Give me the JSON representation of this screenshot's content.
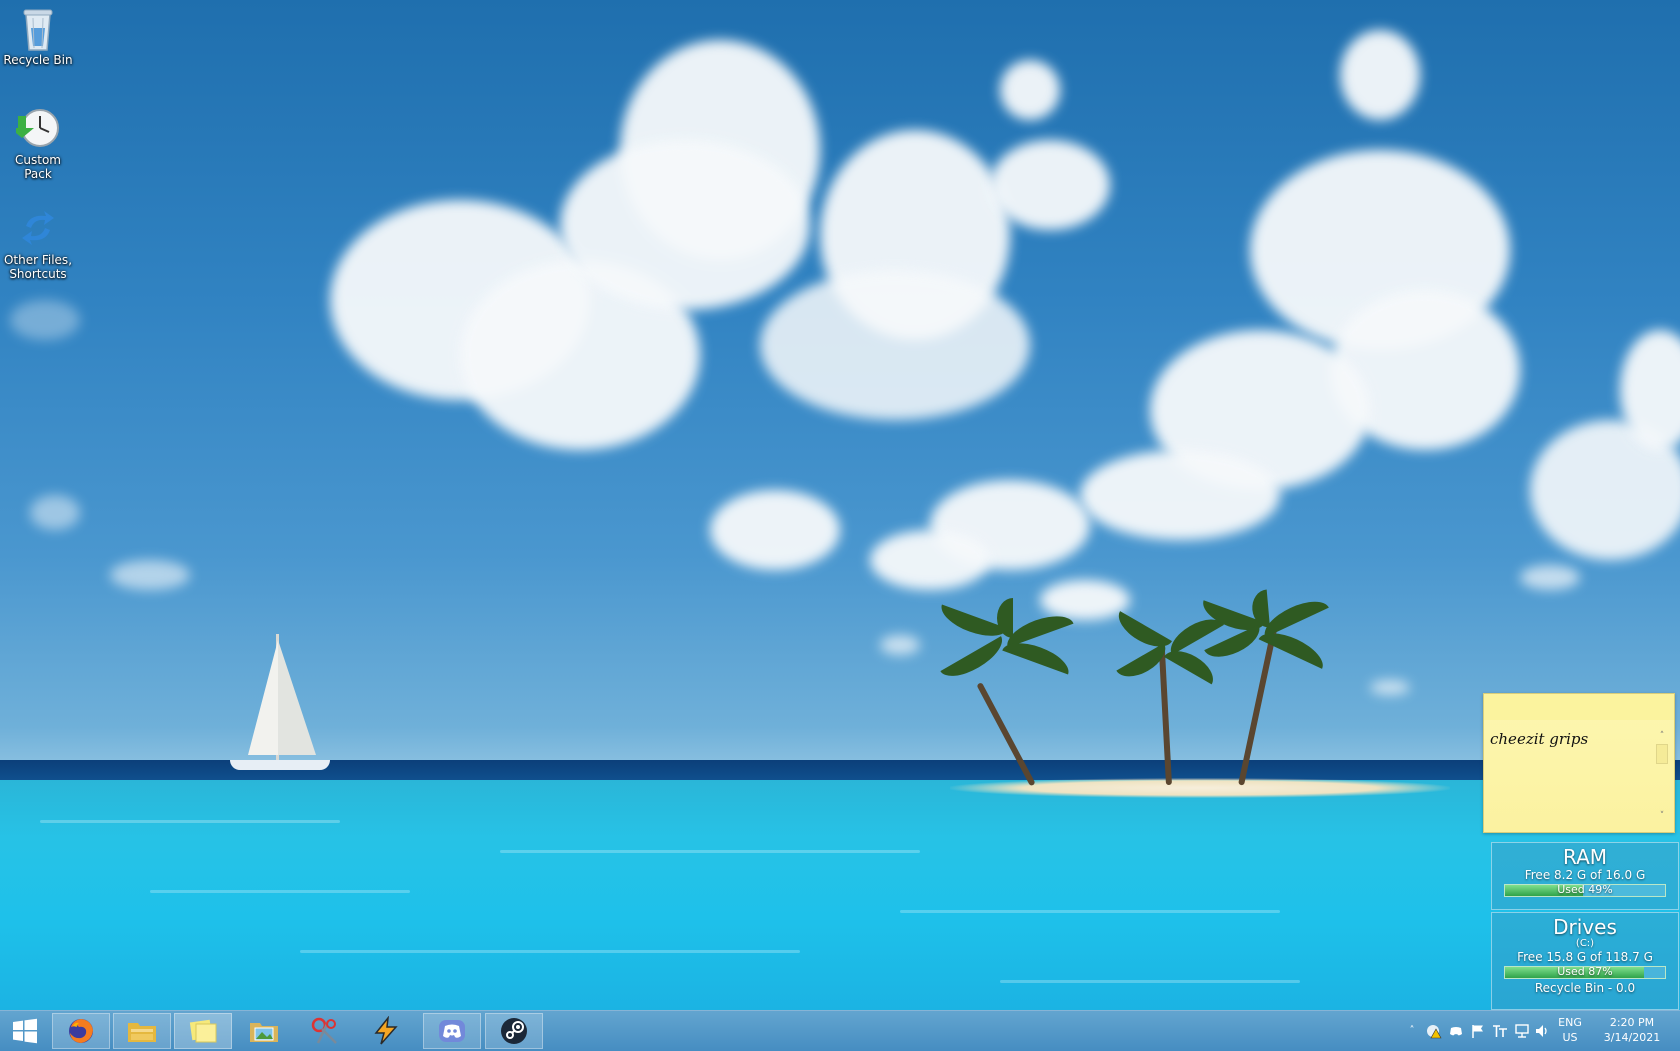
{
  "desktop": {
    "icons": [
      {
        "label": "Recycle Bin",
        "icon": "recycle-bin-icon"
      },
      {
        "label": "Custom Pack",
        "icon": "clock-download-icon"
      },
      {
        "label": "Other Files, Shortcuts",
        "icon": "sync-arrows-icon"
      }
    ]
  },
  "sticky_note": {
    "text": "cheezit grips",
    "scroll_up": "˄",
    "scroll_down": "˅"
  },
  "ram_gadget": {
    "title": "RAM",
    "free_text": "Free 8.2 G of 16.0 G",
    "used_text": "Used 49%",
    "used_fraction": 0.49
  },
  "drives_gadget": {
    "title": "Drives",
    "drive": "(C:)",
    "free_text": "Free 15.8 G of 118.7 G",
    "used_text": "Used 87%",
    "used_fraction": 0.87,
    "recycle_text": "Recycle Bin - 0.0"
  },
  "taskbar": {
    "apps": [
      {
        "name": "start-button",
        "icon": "windows-logo-icon"
      },
      {
        "name": "firefox",
        "icon": "firefox-icon"
      },
      {
        "name": "file-explorer",
        "icon": "folder-icon"
      },
      {
        "name": "sticky-notes",
        "icon": "sticky-notes-icon"
      },
      {
        "name": "pictures-folder",
        "icon": "pictures-folder-icon"
      },
      {
        "name": "snipping-tool",
        "icon": "scissors-icon"
      },
      {
        "name": "winamp",
        "icon": "winamp-icon"
      },
      {
        "name": "discord",
        "icon": "discord-icon"
      },
      {
        "name": "steam",
        "icon": "steam-icon"
      }
    ],
    "tray": {
      "language_top": "ENG",
      "language_bottom": "US",
      "time": "2:20 PM",
      "date": "3/14/2021",
      "overflow": "˄"
    }
  },
  "colors": {
    "taskbar": "#4a93c6",
    "sticky": "#fbf2a0",
    "bar_fill": "#3fb456"
  }
}
